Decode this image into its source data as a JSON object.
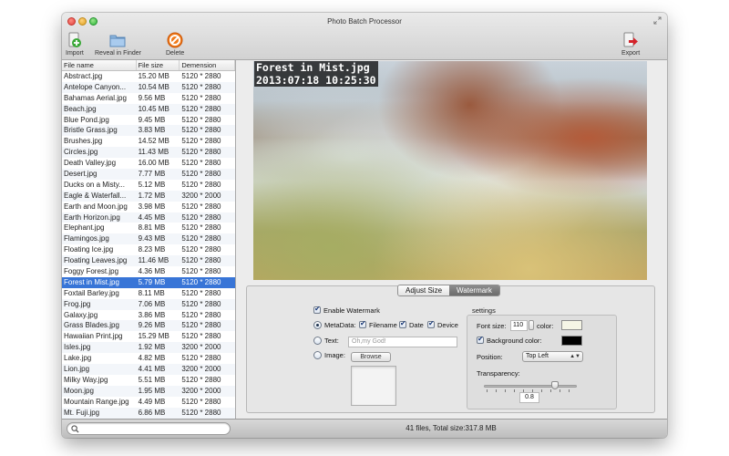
{
  "window": {
    "title": "Photo Batch Processor"
  },
  "toolbar": {
    "import_label": "Import",
    "reveal_label": "Reveal in Finder",
    "delete_label": "Delete",
    "export_label": "Export"
  },
  "file_list": {
    "headers": {
      "name": "File name",
      "size": "File size",
      "dimension": "Demension"
    },
    "rows": [
      {
        "name": "Abstract.jpg",
        "size": "15.20 MB",
        "dimension": "5120 * 2880"
      },
      {
        "name": "Antelope Canyon...",
        "size": "10.54 MB",
        "dimension": "5120 * 2880"
      },
      {
        "name": "Bahamas Aerial.jpg",
        "size": "9.56 MB",
        "dimension": "5120 * 2880"
      },
      {
        "name": "Beach.jpg",
        "size": "10.45 MB",
        "dimension": "5120 * 2880"
      },
      {
        "name": "Blue Pond.jpg",
        "size": "9.45 MB",
        "dimension": "5120 * 2880"
      },
      {
        "name": "Bristle Grass.jpg",
        "size": "3.83 MB",
        "dimension": "5120 * 2880"
      },
      {
        "name": "Brushes.jpg",
        "size": "14.52 MB",
        "dimension": "5120 * 2880"
      },
      {
        "name": "Circles.jpg",
        "size": "11.43 MB",
        "dimension": "5120 * 2880"
      },
      {
        "name": "Death Valley.jpg",
        "size": "16.00 MB",
        "dimension": "5120 * 2880"
      },
      {
        "name": "Desert.jpg",
        "size": "7.77 MB",
        "dimension": "5120 * 2880"
      },
      {
        "name": "Ducks on a Misty...",
        "size": "5.12 MB",
        "dimension": "5120 * 2880"
      },
      {
        "name": "Eagle & Waterfall...",
        "size": "1.72 MB",
        "dimension": "3200 * 2000"
      },
      {
        "name": "Earth and Moon.jpg",
        "size": "3.98 MB",
        "dimension": "5120 * 2880"
      },
      {
        "name": "Earth Horizon.jpg",
        "size": "4.45 MB",
        "dimension": "5120 * 2880"
      },
      {
        "name": "Elephant.jpg",
        "size": "8.81 MB",
        "dimension": "5120 * 2880"
      },
      {
        "name": "Flamingos.jpg",
        "size": "9.43 MB",
        "dimension": "5120 * 2880"
      },
      {
        "name": "Floating Ice.jpg",
        "size": "8.23 MB",
        "dimension": "5120 * 2880"
      },
      {
        "name": "Floating Leaves.jpg",
        "size": "11.46 MB",
        "dimension": "5120 * 2880"
      },
      {
        "name": "Foggy Forest.jpg",
        "size": "4.36 MB",
        "dimension": "5120 * 2880"
      },
      {
        "name": "Forest in Mist.jpg",
        "size": "5.79 MB",
        "dimension": "5120 * 2880",
        "selected": true
      },
      {
        "name": "Foxtail Barley.jpg",
        "size": "8.11 MB",
        "dimension": "5120 * 2880"
      },
      {
        "name": "Frog.jpg",
        "size": "7.06 MB",
        "dimension": "5120 * 2880"
      },
      {
        "name": "Galaxy.jpg",
        "size": "3.86 MB",
        "dimension": "5120 * 2880"
      },
      {
        "name": "Grass Blades.jpg",
        "size": "9.26 MB",
        "dimension": "5120 * 2880"
      },
      {
        "name": "Hawaiian Print.jpg",
        "size": "15.29 MB",
        "dimension": "5120 * 2880"
      },
      {
        "name": "Isles.jpg",
        "size": "1.92 MB",
        "dimension": "3200 * 2000"
      },
      {
        "name": "Lake.jpg",
        "size": "4.82 MB",
        "dimension": "5120 * 2880"
      },
      {
        "name": "Lion.jpg",
        "size": "4.41 MB",
        "dimension": "3200 * 2000"
      },
      {
        "name": "Milky Way.jpg",
        "size": "5.51 MB",
        "dimension": "5120 * 2880"
      },
      {
        "name": "Moon.jpg",
        "size": "1.95 MB",
        "dimension": "3200 * 2000"
      },
      {
        "name": "Mountain Range.jpg",
        "size": "4.49 MB",
        "dimension": "5120 * 2880"
      },
      {
        "name": "Mt. Fuji.jpg",
        "size": "6.86 MB",
        "dimension": "5120 * 2880"
      }
    ]
  },
  "preview": {
    "overlay_filename": "Forest in Mist.jpg",
    "overlay_datetime": "2013:07:18 10:25:30"
  },
  "tabs": {
    "adjust_size": "Adjust Size",
    "watermark": "Watermark",
    "active": "watermark"
  },
  "watermark": {
    "enable_label": "Enable Watermark",
    "enable_checked": true,
    "metadata_label": "MetaData:",
    "metadata_selected": true,
    "filename_label": "Filename",
    "filename_checked": true,
    "date_label": "Date",
    "date_checked": true,
    "device_label": "Device",
    "device_checked": true,
    "text_label": "Text:",
    "text_placeholder": "Oh,my God!",
    "image_label": "Image:",
    "browse_label": "Browse"
  },
  "settings": {
    "title": "settings",
    "font_size_label": "Font size:",
    "font_size_value": "110",
    "color_label": "color:",
    "font_color": "#f5f5e6",
    "background_color_label": "Background color:",
    "background_color_checked": true,
    "background_color": "#000000",
    "position_label": "Position:",
    "position_value": "Top Left",
    "transparency_label": "Transparency:",
    "transparency_value": "0.8"
  },
  "status": {
    "summary": "41 files, Total size:317.8 MB"
  },
  "search": {
    "placeholder": ""
  }
}
